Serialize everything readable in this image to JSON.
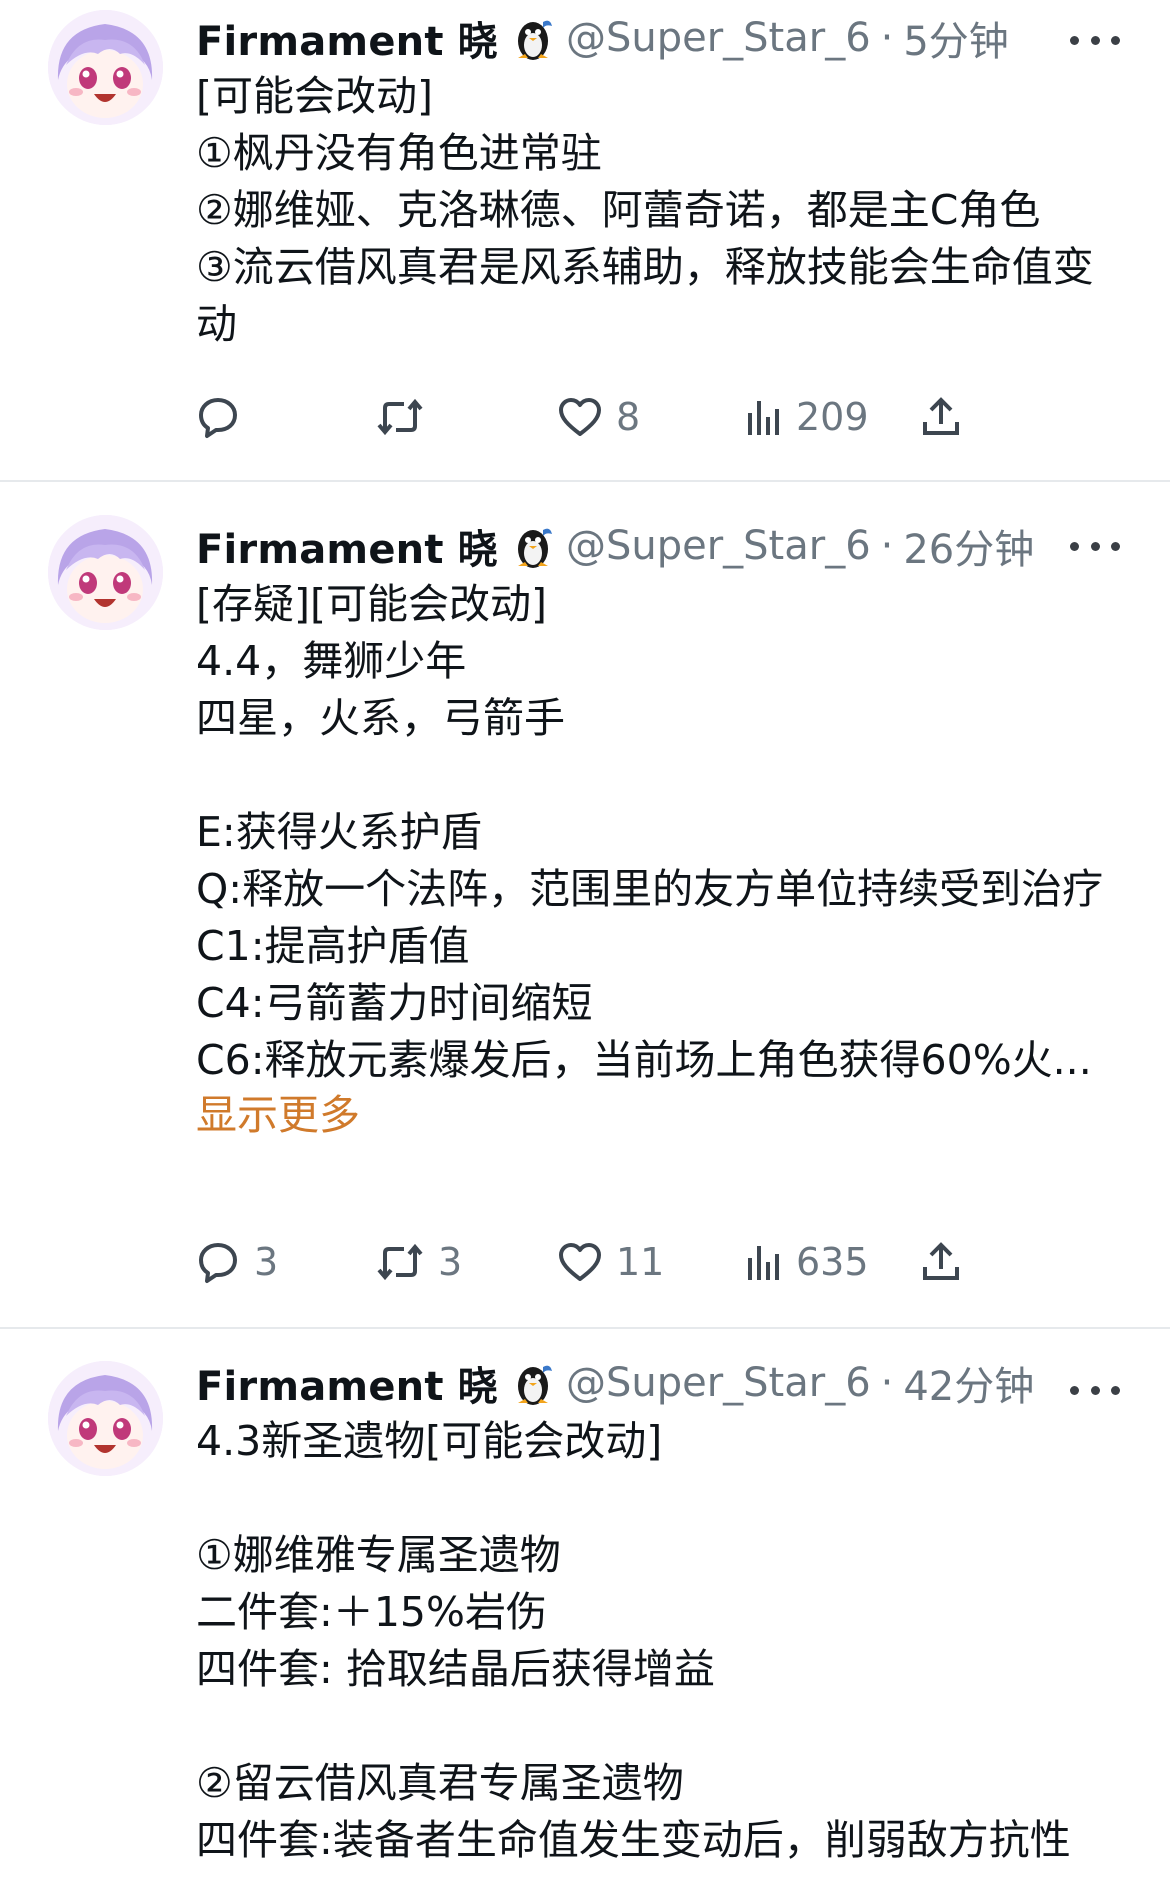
{
  "tweets": [
    {
      "name": "Firmament 晓",
      "handle": "@Super_Star_6",
      "separator": "·",
      "time": "5分钟",
      "body": "[可能会改动]\n①枫丹没有角色进常驻\n②娜维娅、克洛琳德、阿蕾奇诺，都是主C角色\n③流云借风真君是风系辅助，释放技能会生命值变动",
      "show_more": "",
      "replies": "",
      "retweets": "",
      "likes": "8",
      "views": "209"
    },
    {
      "name": "Firmament 晓",
      "handle": "@Super_Star_6",
      "separator": "·",
      "time": "26分钟",
      "body": "[存疑][可能会改动]\n4.4，舞狮少年\n四星，火系，弓箭手\n\nE:获得火系护盾\nQ:释放一个法阵，范围里的友方单位持续受到治疗\nC1:提高护盾值\nC4:弓箭蓄力时间缩短\nC6:释放元素爆发后，当前场上角色获得60%火...",
      "show_more": "显示更多",
      "replies": "3",
      "retweets": "3",
      "likes": "11",
      "views": "635"
    },
    {
      "name": "Firmament 晓",
      "handle": "@Super_Star_6",
      "separator": "·",
      "time": "42分钟",
      "body": "4.3新圣遗物[可能会改动]\n\n①娜维雅专属圣遗物\n二件套:＋15%岩伤\n四件套: 拾取结晶后获得增益\n\n②留云借风真君专属圣遗物\n四件套:装备者生命值发生变动后，削弱敌方抗性"
    }
  ],
  "icons": {
    "reply": "reply-icon",
    "retweet": "retweet-icon",
    "like": "heart-icon",
    "views": "views-icon",
    "share": "share-icon",
    "more": "more-icon",
    "badge": "penguin-badge-icon",
    "avatar": "anime-avatar"
  },
  "colors": {
    "text": "#0f1419",
    "secondary": "#6b7680",
    "link": "#d07a2b",
    "divider": "#e6e9ec"
  }
}
